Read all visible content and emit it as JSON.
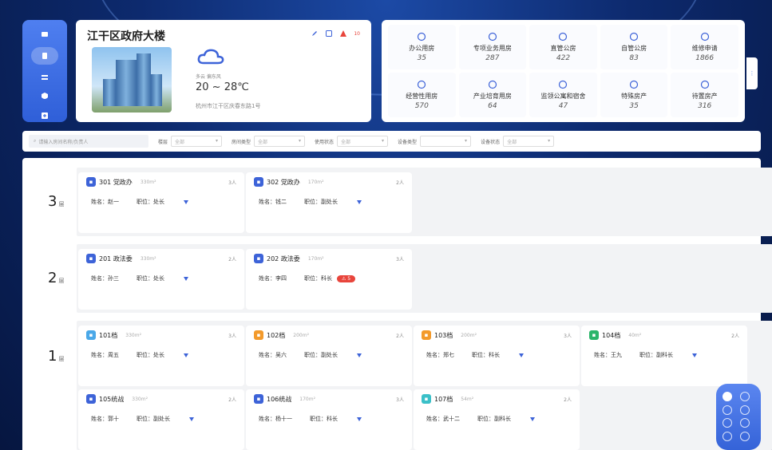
{
  "building": {
    "name": "江干区政府大楼",
    "weather": {
      "desc": "多云 偏东风",
      "temp": "20 ~ 28℃"
    },
    "address": "杭州市江干区庆春东路1号",
    "alert_count": "10"
  },
  "stats": [
    {
      "label": "办公用房",
      "value": "35",
      "icon": "building-icon"
    },
    {
      "label": "专项业务用房",
      "value": "287",
      "icon": "clock-icon"
    },
    {
      "label": "直管公房",
      "value": "422",
      "icon": "bag-icon"
    },
    {
      "label": "自管公房",
      "value": "83",
      "icon": "server-icon"
    },
    {
      "label": "维修申请",
      "value": "1866",
      "icon": "cloud-icon"
    },
    {
      "label": "经营性用房",
      "value": "570",
      "icon": "cart-icon"
    },
    {
      "label": "产业培育用房",
      "value": "64",
      "icon": "shield-icon"
    },
    {
      "label": "监领公寓和宿舍",
      "value": "47",
      "icon": "doc-icon"
    },
    {
      "label": "特殊房产",
      "value": "35",
      "icon": "house-icon"
    },
    {
      "label": "待置房产",
      "value": "316",
      "icon": "screen-icon"
    }
  ],
  "filters": {
    "search_placeholder": "请输入房间名称/负责人",
    "items": [
      {
        "label": "楼层",
        "value": "全部"
      },
      {
        "label": "房间类型",
        "value": "全部"
      },
      {
        "label": "使用状态",
        "value": "全部"
      },
      {
        "label": "设备类型",
        "value": ""
      },
      {
        "label": "设备状态",
        "value": "全部"
      }
    ]
  },
  "floors": [
    {
      "label": "3",
      "unit": "层",
      "rooms": [
        {
          "name": "301 党政办",
          "area": "330m²",
          "people": "3人",
          "person": "姓名：赵一",
          "position": "职位：处长",
          "color": "#3d63d8"
        },
        {
          "name": "302 党政办",
          "area": "170m²",
          "people": "2人",
          "person": "姓名：钱二",
          "position": "职位：副处长",
          "color": "#3d63d8"
        }
      ]
    },
    {
      "label": "2",
      "unit": "层",
      "rooms": [
        {
          "name": "201 政法委",
          "area": "330m²",
          "people": "2人",
          "person": "姓名：孙三",
          "position": "职位：处长",
          "color": "#3d63d8"
        },
        {
          "name": "202 政法委",
          "area": "170m²",
          "people": "3人",
          "person": "姓名：李四",
          "position": "职位：科长",
          "color": "#3d63d8",
          "alert": "⚠ 5"
        }
      ]
    },
    {
      "label": "1",
      "unit": "层",
      "rooms": [
        {
          "name": "101档",
          "area": "330m²",
          "people": "3人",
          "person": "姓名：周五",
          "position": "职位：处长",
          "color": "#4aa8e8"
        },
        {
          "name": "102档",
          "area": "200m²",
          "people": "2人",
          "person": "姓名：吴六",
          "position": "职位：副处长",
          "color": "#f39a2b"
        },
        {
          "name": "103档",
          "area": "200m²",
          "people": "3人",
          "person": "姓名：郑七",
          "position": "职位：科长",
          "color": "#f39a2b"
        },
        {
          "name": "104档",
          "area": "40m²",
          "people": "2人",
          "person": "姓名：王九",
          "position": "职位：副科长",
          "color": "#2bb56a"
        },
        {
          "name": "105统战",
          "area": "330m²",
          "people": "2人",
          "person": "姓名：郭十",
          "position": "职位：副处长",
          "color": "#3d63d8"
        },
        {
          "name": "106统战",
          "area": "170m²",
          "people": "3人",
          "person": "姓名：杨十一",
          "position": "职位：科长",
          "color": "#3d63d8"
        },
        {
          "name": "107档",
          "area": "54m²",
          "people": "2人",
          "person": "姓名：武十二",
          "position": "职位：副科长",
          "color": "#3bc0c8"
        }
      ]
    }
  ]
}
